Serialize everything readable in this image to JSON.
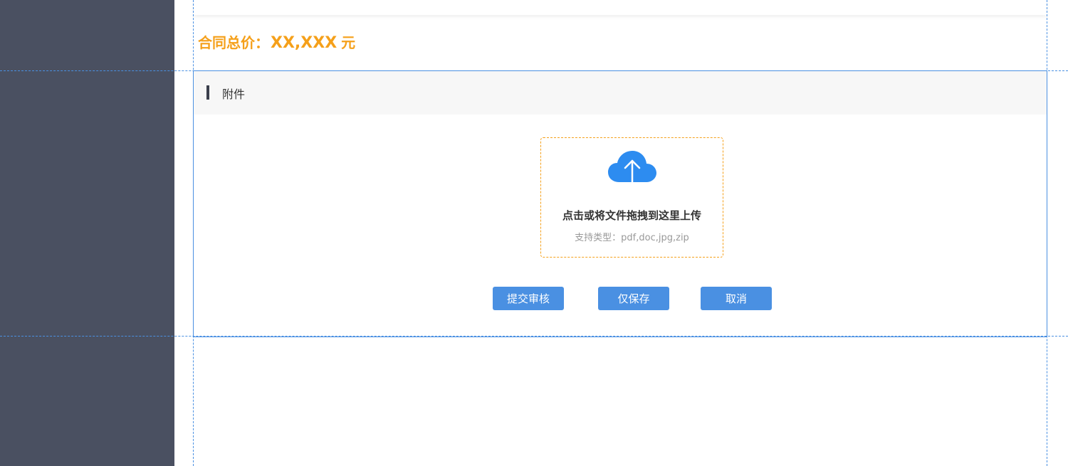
{
  "summary": {
    "total_label": "合同总价：",
    "total_amount": "XX,XXX",
    "total_unit": "元"
  },
  "attachments": {
    "title": "附件",
    "upload": {
      "icon": "cloud-upload-icon",
      "main_text": "点击或将文件拖拽到这里上传",
      "supported_types": "支持类型：pdf,doc,jpg,zip"
    }
  },
  "actions": {
    "submit_label": "提交审核",
    "save_label": "仅保存",
    "cancel_label": "取消"
  },
  "colors": {
    "sidebar": "#4a5061",
    "accent_orange": "#f5a01a",
    "primary_blue": "#4a90e2",
    "upload_icon_blue": "#2d8cf0"
  }
}
